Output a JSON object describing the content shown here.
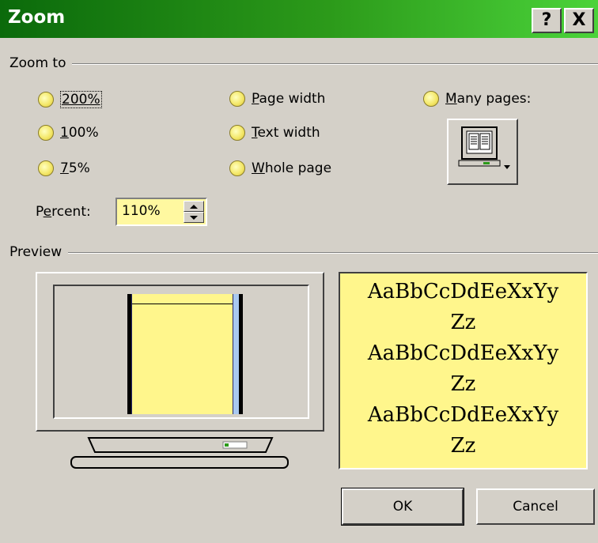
{
  "window": {
    "title": "Zoom",
    "help_label": "?",
    "close_label": "X"
  },
  "zoom_to": {
    "legend": "Zoom to",
    "options": [
      {
        "label": "200%",
        "mnemonic_index": 0
      },
      {
        "label": "100%",
        "mnemonic_index": 0
      },
      {
        "label": "75%",
        "mnemonic_index": 0
      },
      {
        "label": "Page width",
        "mnemonic_index": 0
      },
      {
        "label": "Text width",
        "mnemonic_index": 0
      },
      {
        "label": "Whole page",
        "mnemonic_index": 0
      },
      {
        "label": "Many pages:",
        "mnemonic_index": 0
      }
    ],
    "percent": {
      "label_pre": "P",
      "label_mn": "e",
      "label_post": "rcent:",
      "value": "110%"
    }
  },
  "preview": {
    "legend": "Preview",
    "sample_lines": [
      "AaBbCcDdEeXxYy",
      "Zz",
      "AaBbCcDdEeXxYy",
      "Zz",
      "AaBbCcDdEeXxYy",
      "Zz"
    ]
  },
  "buttons": {
    "ok": "OK",
    "cancel": "Cancel"
  },
  "colors": {
    "title_gradient_start": "#0b6a0b",
    "title_gradient_end": "#4bd33a",
    "face": "#d4d0c8",
    "highlight_yellow": "#fff68c"
  }
}
